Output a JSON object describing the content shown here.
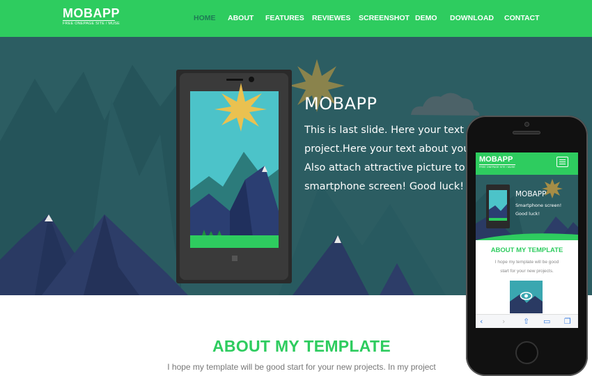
{
  "header": {
    "logo_title": "MOBAPP",
    "logo_subtitle": "FREE ONEPAGE SITE / MUSE",
    "nav": [
      {
        "label": "HOME",
        "active": true
      },
      {
        "label": "ABOUT"
      },
      {
        "label": "FEATURES"
      },
      {
        "label": "REVIEWES"
      },
      {
        "label": "SCREENSHOT"
      },
      {
        "label": "DEMO"
      },
      {
        "label": "DOWNLOAD"
      },
      {
        "label": "CONTACT"
      }
    ]
  },
  "hero": {
    "title": "MOBAPP",
    "lines": [
      "This is last slide. Here your text a",
      "project.Here your text about you",
      "Also attach attractive picture to",
      "smartphone screen! Good luck!"
    ]
  },
  "about": {
    "title": "ABOUT MY TEMPLATE",
    "text": "I hope my template will be good start for your new projects. In my project"
  },
  "mobile": {
    "logo_title": "MOBAPP",
    "logo_subtitle": "FREE ONEPAGE SITE / MUSE",
    "hero_title": "MOBAPP",
    "hero_line1": "Smartphone screen!",
    "hero_line2": "Good luck!",
    "about_title": "ABOUT MY TEMPLATE",
    "about_line1": "I hope my template will be good",
    "about_line2": "start for your new projects.",
    "toolbar_icons": [
      "back-icon",
      "forward-icon",
      "share-icon",
      "bookmarks-icon",
      "tabs-icon"
    ]
  },
  "colors": {
    "brand_green": "#2ecc5f",
    "hero_bg": "#2c5d62",
    "mountain_dark": "#2a3a63",
    "active_nav": "#1e7a55"
  }
}
